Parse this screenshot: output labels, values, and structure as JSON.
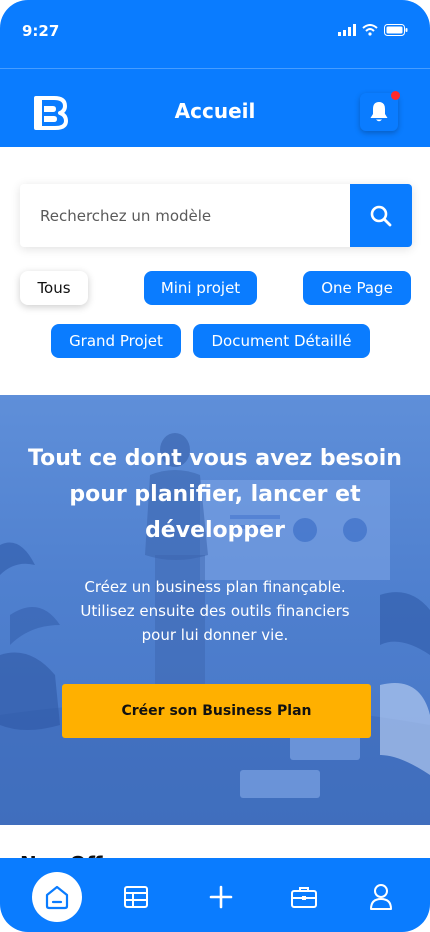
{
  "status_bar": {
    "time": "9:27"
  },
  "header": {
    "title": "Accueil"
  },
  "search": {
    "placeholder": "Recherchez un modèle"
  },
  "filters": [
    {
      "label": "Tous",
      "active": true
    },
    {
      "label": "Mini projet",
      "active": false
    },
    {
      "label": "One Page",
      "active": false
    },
    {
      "label": "Grand Projet",
      "active": false
    },
    {
      "label": "Document Détaillé",
      "active": false
    }
  ],
  "hero": {
    "title_line1": "Tout ce dont vous avez besoin",
    "title_line2": "pour planifier, lancer et",
    "title_line3": "développer",
    "subtitle_line1": "Créez un business plan finançable.",
    "subtitle_line2": "Utilisez ensuite des outils financiers",
    "subtitle_line3": "pour lui donner vie.",
    "cta_label": "Créer son Business Plan"
  },
  "next_section": {
    "title_peek": "Nos Offres"
  },
  "bottom_nav": [
    {
      "name": "home",
      "icon": "home-icon",
      "active": true
    },
    {
      "name": "templates",
      "icon": "table-icon",
      "active": false
    },
    {
      "name": "add",
      "icon": "plus-icon",
      "active": false
    },
    {
      "name": "portfolio",
      "icon": "briefcase-icon",
      "active": false
    },
    {
      "name": "profile",
      "icon": "user-icon",
      "active": false
    }
  ],
  "colors": {
    "primary": "#0a7cff",
    "accent": "#ffb000",
    "notification": "#ff2a2a"
  }
}
